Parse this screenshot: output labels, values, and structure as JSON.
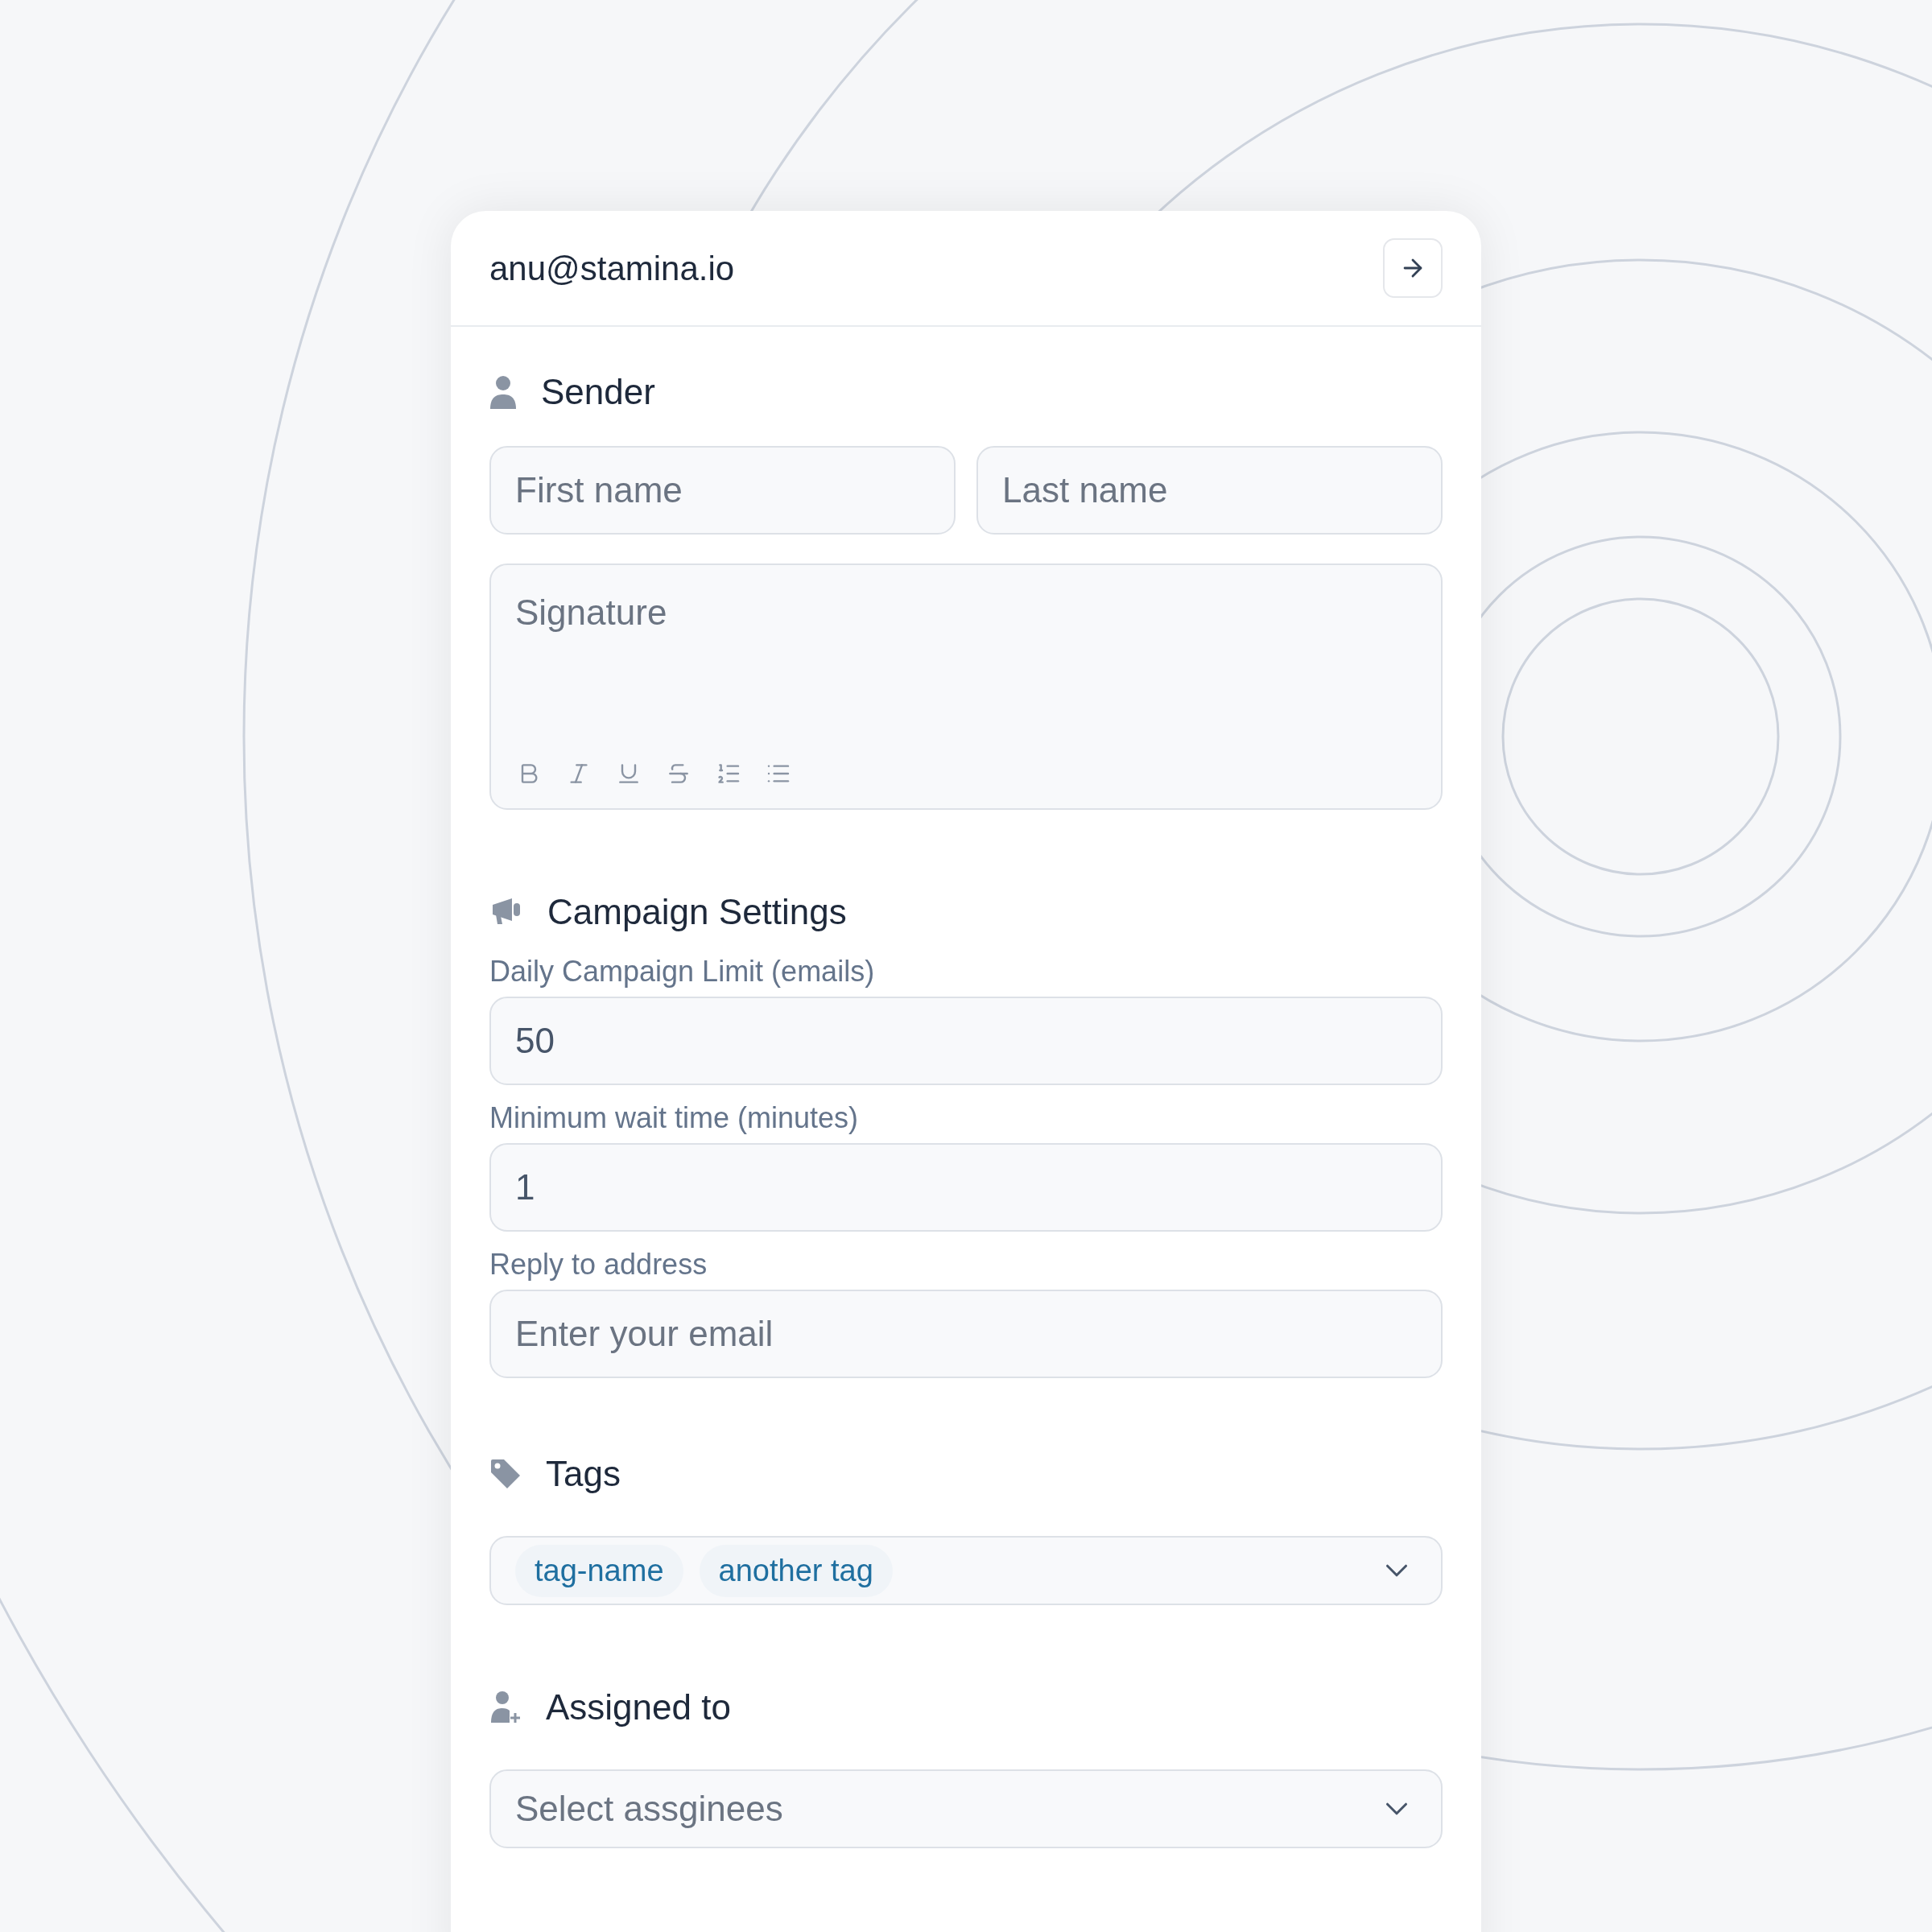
{
  "header": {
    "email": "anu@stamina.io"
  },
  "sender": {
    "title": "Sender",
    "first_name": {
      "placeholder": "First name"
    },
    "last_name": {
      "placeholder": "Last name"
    },
    "signature": {
      "placeholder": "Signature"
    },
    "toolbar": [
      {
        "kind": "bold"
      },
      {
        "kind": "italic"
      },
      {
        "kind": "underline"
      },
      {
        "kind": "strike"
      },
      {
        "kind": "ordered"
      },
      {
        "kind": "bullet"
      }
    ]
  },
  "campaign": {
    "title": "Campaign Settings",
    "fields": [
      {
        "label": "Daily Campaign Limit (emails)",
        "value": "50"
      },
      {
        "label": "Minimum wait time (minutes)",
        "value": "1"
      },
      {
        "label": "Reply to address",
        "placeholder": "Enter your email"
      }
    ]
  },
  "tags": {
    "title": "Tags",
    "items": [
      "tag-name",
      "another tag"
    ]
  },
  "assigned": {
    "title": "Assigned to",
    "placeholder": "Select assginees"
  }
}
